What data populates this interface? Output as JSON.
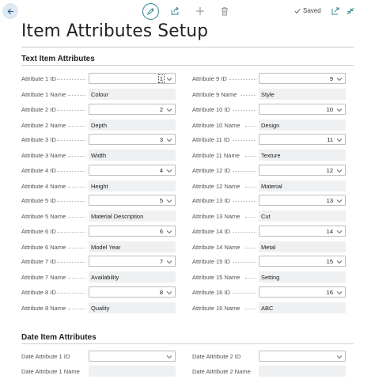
{
  "toolbar": {
    "back_icon": "back-arrow-icon",
    "edit_icon": "pencil-icon",
    "share_icon": "share-icon",
    "new_icon": "plus-icon",
    "delete_icon": "trash-icon",
    "saved_label": "Saved",
    "openinnew_icon": "open-in-new-window-icon",
    "collapse_icon": "collapse-icon",
    "accent_color": "#2b8591"
  },
  "page": {
    "title": "Item Attributes Setup"
  },
  "text_section": {
    "title": "Text Item Attributes",
    "left": [
      {
        "id_label": "Attribute 1 ID",
        "id_value": "1",
        "name_label": "Attribute 1 Name",
        "name_value": "Colour"
      },
      {
        "id_label": "Attribute 2 ID",
        "id_value": "2",
        "name_label": "Attribute 2 Name",
        "name_value": "Depth"
      },
      {
        "id_label": "Attribute 3 ID",
        "id_value": "3",
        "name_label": "Attribute 3 Name",
        "name_value": "Width"
      },
      {
        "id_label": "Attribute 4 ID",
        "id_value": "4",
        "name_label": "Attribute 4 Name",
        "name_value": "Height"
      },
      {
        "id_label": "Attribute 5 ID",
        "id_value": "5",
        "name_label": "Attribute 5 Name",
        "name_value": "Material Description"
      },
      {
        "id_label": "Attribute 6 ID",
        "id_value": "6",
        "name_label": "Attribute 6 Name",
        "name_value": "Model Year"
      },
      {
        "id_label": "Attribute 7 ID",
        "id_value": "7",
        "name_label": "Attribute 7 Name",
        "name_value": "Availability"
      },
      {
        "id_label": "Attribute 8 ID",
        "id_value": "8",
        "name_label": "Attribute 8 Name",
        "name_value": "Quality"
      }
    ],
    "right": [
      {
        "id_label": "Attribute 9 ID",
        "id_value": "9",
        "name_label": "Attribute 9 Name",
        "name_value": "Style"
      },
      {
        "id_label": "Attribute 10 ID",
        "id_value": "10",
        "name_label": "Attribute 10 Name",
        "name_value": "Design"
      },
      {
        "id_label": "Attribute 11 ID",
        "id_value": "11",
        "name_label": "Attribute 11 Name",
        "name_value": "Texture"
      },
      {
        "id_label": "Attribute 12 ID",
        "id_value": "12",
        "name_label": "Attribute 12 Name",
        "name_value": "Material"
      },
      {
        "id_label": "Attribute 13 ID",
        "id_value": "13",
        "name_label": "Attribute 13 Name",
        "name_value": "Cut"
      },
      {
        "id_label": "Attribute 14 ID",
        "id_value": "14",
        "name_label": "Attribute 14 Name",
        "name_value": "Metal"
      },
      {
        "id_label": "Attribute 15 ID",
        "id_value": "15",
        "name_label": "Attribute 15 Name",
        "name_value": "Setting"
      },
      {
        "id_label": "Attribute 16 ID",
        "id_value": "16",
        "name_label": "Attribute 16 Name",
        "name_value": "ABC"
      }
    ]
  },
  "date_section": {
    "title": "Date Item Attributes",
    "left": {
      "id_label": "Date Attribute 1 ID",
      "id_value": "",
      "name_label": "Date Attribute 1 Name",
      "name_value": ""
    },
    "right": {
      "id_label": "Date Attribute 2 ID",
      "id_value": "",
      "name_label": "Date Attribute 2 Name",
      "name_value": ""
    }
  }
}
